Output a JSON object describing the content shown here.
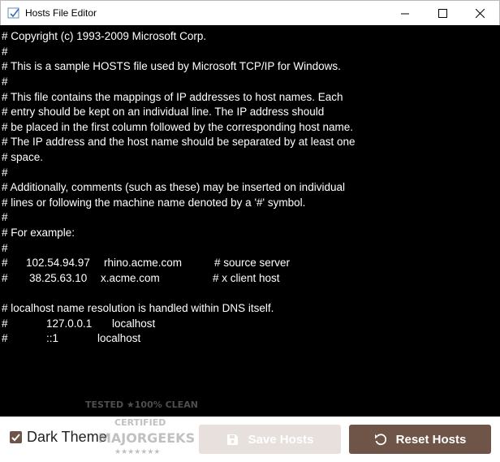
{
  "window": {
    "title": "Hosts File Editor",
    "icons": [
      "app-icon",
      "minimize-icon",
      "maximize-icon",
      "close-icon"
    ]
  },
  "editor": {
    "lines": [
      "# Copyright (c) 1993-2009 Microsoft Corp.",
      "#",
      "# This is a sample HOSTS file used by Microsoft TCP/IP for Windows.",
      "#",
      "# This file contains the mappings of IP addresses to host names. Each",
      "# entry should be kept on an individual line. The IP address should",
      "# be placed in the first column followed by the corresponding host name.",
      "# The IP address and the host name should be separated by at least one",
      "# space.",
      "#",
      "# Additionally, comments (such as these) may be inserted on individual",
      "# lines or following the machine name denoted by a '#' symbol.",
      "#",
      "# For example:",
      "#"
    ],
    "example1": {
      "hash": "#",
      "ip": "102.54.94.97",
      "host": "rhino.acme.com",
      "comment": "# source server"
    },
    "example2": {
      "hash": "#",
      "ip": "38.25.63.10",
      "host": "x.acme.com",
      "comment": "# x client host"
    },
    "localhost_note": "# localhost name resolution is handled within DNS itself.",
    "local1": {
      "hash": "#",
      "ip": "127.0.0.1",
      "host": "localhost"
    },
    "local2": {
      "hash": "#",
      "ip": "::1",
      "host": "localhost"
    },
    "background": "#000000",
    "text_color": "#ffffff"
  },
  "footer": {
    "dark_theme_label": "Dark Theme",
    "dark_theme_checked": true,
    "save_label": "Save Hosts",
    "reset_label": "Reset Hosts",
    "save_icon": "floppy-disk-icon",
    "reset_icon": "reset-arrow-icon",
    "accent": "#6f5448",
    "disabled": "#e7e0dd"
  },
  "watermark": {
    "line1": "TESTED ★100% CLEAN",
    "line2": "CERTIFIED",
    "line3": "MAJORGEEKS",
    "line4": "★★★★★★★"
  }
}
